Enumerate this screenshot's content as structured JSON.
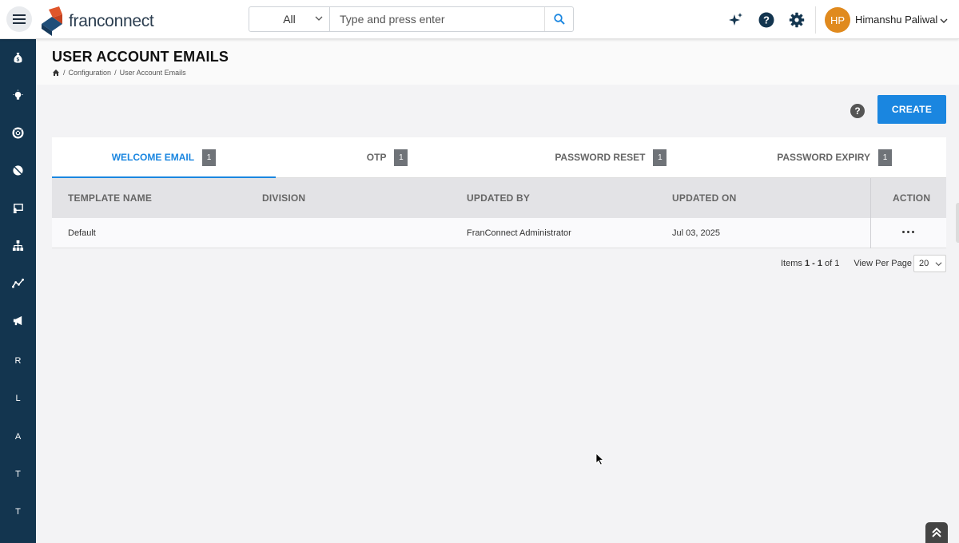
{
  "app": {
    "brand": "franconnect",
    "colors": {
      "accent": "#1a86e0",
      "sidebar": "#13354f",
      "avatar": "#e08a1e"
    }
  },
  "search": {
    "category": "All",
    "placeholder": "Type and press enter"
  },
  "user": {
    "initials": "HP",
    "name": "Himanshu Paliwal"
  },
  "sidebar": {
    "items": [
      {
        "icon": "money-bag-icon"
      },
      {
        "icon": "lightbulb-icon"
      },
      {
        "icon": "lifebuoy-icon"
      },
      {
        "icon": "pill-icon"
      },
      {
        "icon": "training-icon"
      },
      {
        "icon": "org-chart-icon"
      },
      {
        "icon": "trend-icon"
      },
      {
        "icon": "megaphone-icon"
      },
      {
        "label": "R"
      },
      {
        "label": "L"
      },
      {
        "label": "A"
      },
      {
        "label": "T"
      },
      {
        "label": "T"
      }
    ]
  },
  "page": {
    "title": "USER ACCOUNT EMAILS",
    "breadcrumb": [
      "Configuration",
      "User Account Emails"
    ],
    "create_label": "CREATE"
  },
  "tabs": [
    {
      "label": "WELCOME EMAIL",
      "count": "1",
      "active": true
    },
    {
      "label": "OTP",
      "count": "1",
      "active": false
    },
    {
      "label": "PASSWORD RESET",
      "count": "1",
      "active": false
    },
    {
      "label": "PASSWORD EXPIRY",
      "count": "1",
      "active": false
    }
  ],
  "table": {
    "columns": [
      "TEMPLATE NAME",
      "DIVISION",
      "UPDATED BY",
      "UPDATED ON",
      "ACTION"
    ],
    "rows": [
      {
        "template_name": "Default",
        "division": "",
        "updated_by": "FranConnect Administrator",
        "updated_on": "Jul 03, 2025"
      }
    ]
  },
  "pagination": {
    "items_prefix": "Items",
    "range": "1 - 1",
    "of_label": "of",
    "total": "1",
    "per_page_label": "View Per Page",
    "per_page": "20"
  }
}
